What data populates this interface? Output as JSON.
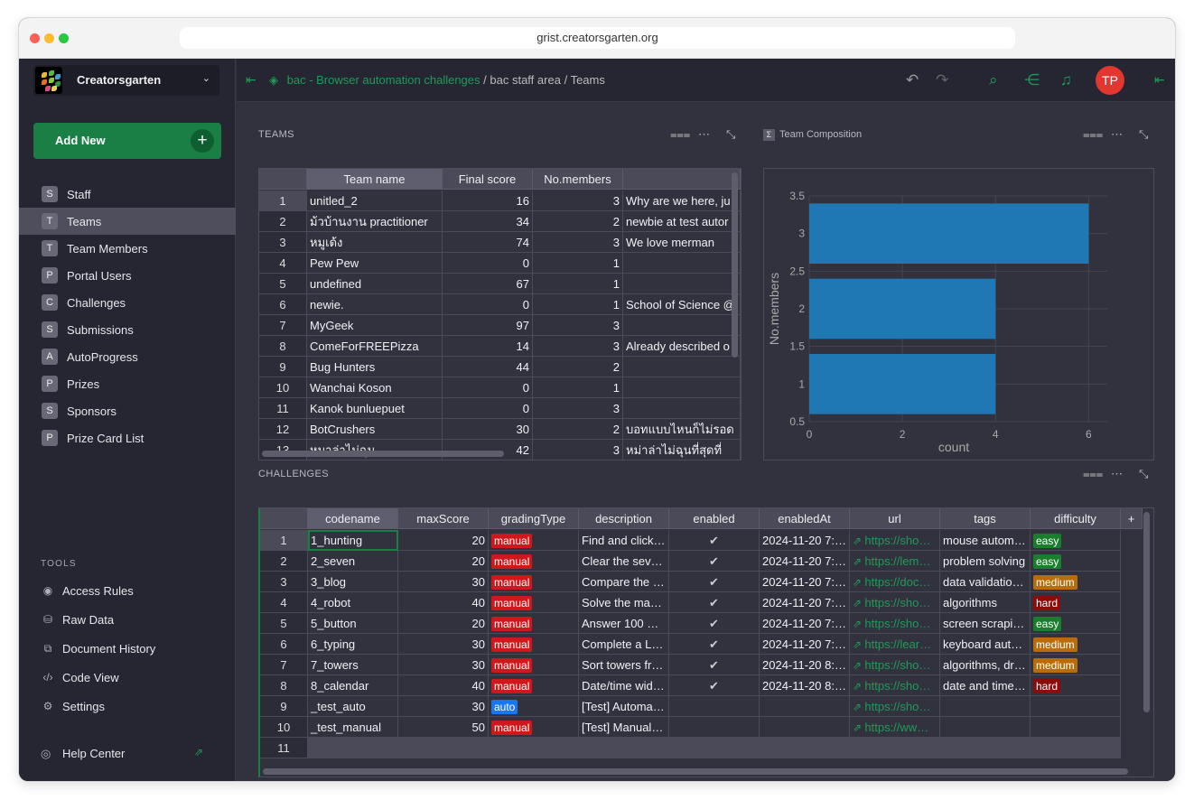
{
  "browser": {
    "url": "grist.creatorsgarten.org"
  },
  "org": {
    "name": "Creatorsgarten"
  },
  "sidebar": {
    "add_new": "Add New",
    "pages": [
      {
        "icon": "S",
        "label": "Staff"
      },
      {
        "icon": "T",
        "label": "Teams",
        "selected": true
      },
      {
        "icon": "T",
        "label": "Team Members"
      },
      {
        "icon": "P",
        "label": "Portal Users"
      },
      {
        "icon": "C",
        "label": "Challenges"
      },
      {
        "icon": "S",
        "label": "Submissions"
      },
      {
        "icon": "A",
        "label": "AutoProgress"
      },
      {
        "icon": "P",
        "label": "Prizes"
      },
      {
        "icon": "S",
        "label": "Sponsors"
      },
      {
        "icon": "P",
        "label": "Prize Card List"
      }
    ],
    "tools_heading": "TOOLS",
    "tools": [
      {
        "icon": "eye-icon",
        "label": "Access Rules"
      },
      {
        "icon": "database-icon",
        "label": "Raw Data"
      },
      {
        "icon": "history-icon",
        "label": "Document History"
      },
      {
        "icon": "code-icon",
        "label": "Code View"
      },
      {
        "icon": "gear-icon",
        "label": "Settings"
      }
    ],
    "help": "Help Center"
  },
  "topbar": {
    "breadcrumb": {
      "doc": "bac - Browser automation challenges",
      "sep1": "/",
      "workspace": "bac staff area",
      "sep2": "/",
      "page": "Teams"
    },
    "avatar_initials": "TP"
  },
  "teams": {
    "title": "TEAMS",
    "columns": [
      "Team name",
      "Final score",
      "No.members",
      ""
    ],
    "rows": [
      [
        "1",
        "unitled_2",
        "16",
        "3",
        "Why are we here, ju"
      ],
      [
        "2",
        "ม้วบ้านงาน practitioner",
        "34",
        "2",
        "newbie at test autor"
      ],
      [
        "3",
        "หมูเด้ง",
        "74",
        "3",
        "We love merman"
      ],
      [
        "4",
        "Pew Pew",
        "0",
        "1",
        ""
      ],
      [
        "5",
        "undefined",
        "67",
        "1",
        ""
      ],
      [
        "6",
        "newie.",
        "0",
        "1",
        "School of Science @"
      ],
      [
        "7",
        "MyGeek",
        "97",
        "3",
        ""
      ],
      [
        "8",
        "ComeForFREEPizza",
        "14",
        "3",
        "Already described o"
      ],
      [
        "9",
        "Bug Hunters",
        "44",
        "2",
        ""
      ],
      [
        "10",
        "Wanchai Koson",
        "0",
        "1",
        ""
      ],
      [
        "11",
        "Kanok bunluepuet",
        "0",
        "3",
        ""
      ],
      [
        "12",
        "BotCrushers",
        "30",
        "2",
        "บอทแบบไหนก็ไม่รอด"
      ],
      [
        "13",
        "หมาล่าไม่ฉุน",
        "42",
        "3",
        "หม่าล่าไม่ฉุนที่สุดที่"
      ]
    ]
  },
  "chart_widget": {
    "title": "Team Composition"
  },
  "chart_data": {
    "type": "bar",
    "orientation": "horizontal",
    "categories": [
      1,
      2,
      3
    ],
    "values": [
      4,
      4,
      6
    ],
    "xlabel": "count",
    "ylabel": "No.members",
    "xlim": [
      0,
      6.4
    ],
    "ylim": [
      0.5,
      3.5
    ],
    "xticks": [
      "0",
      "2",
      "4",
      "6"
    ],
    "yticks": [
      "0.5",
      "1",
      "1.5",
      "2",
      "2.5",
      "3",
      "3.5"
    ],
    "color": "#1f77b4",
    "grid": true
  },
  "challenges": {
    "title": "CHALLENGES",
    "columns": [
      "codename",
      "maxScore",
      "gradingType",
      "description",
      "enabled",
      "enabledAt",
      "url",
      "tags",
      "difficulty",
      "+"
    ],
    "rows": [
      {
        "n": "1",
        "codename": "1_hunting",
        "maxScore": "20",
        "grading": "manual",
        "description": "Find and click…",
        "enabled": "✔",
        "enabledAt": "2024-11-20 7:…",
        "url": "https://sho…",
        "tags": "mouse autom…",
        "difficulty": "easy"
      },
      {
        "n": "2",
        "codename": "2_seven",
        "maxScore": "20",
        "grading": "manual",
        "description": "Clear the sev…",
        "enabled": "✔",
        "enabledAt": "2024-11-20 7:…",
        "url": "https://lem…",
        "tags": "problem solving",
        "difficulty": "easy"
      },
      {
        "n": "3",
        "codename": "3_blog",
        "maxScore": "30",
        "grading": "manual",
        "description": "Compare the …",
        "enabled": "✔",
        "enabledAt": "2024-11-20 7:…",
        "url": "https://doc…",
        "tags": "data validatio…",
        "difficulty": "medium"
      },
      {
        "n": "4",
        "codename": "4_robot",
        "maxScore": "40",
        "grading": "manual",
        "description": "Solve the ma…",
        "enabled": "✔",
        "enabledAt": "2024-11-20 7:…",
        "url": "https://sho…",
        "tags": "algorithms",
        "difficulty": "hard"
      },
      {
        "n": "5",
        "codename": "5_button",
        "maxScore": "20",
        "grading": "manual",
        "description": "Answer 100 …",
        "enabled": "✔",
        "enabledAt": "2024-11-20 7:…",
        "url": "https://sho…",
        "tags": "screen scrapi…",
        "difficulty": "easy"
      },
      {
        "n": "6",
        "codename": "6_typing",
        "maxScore": "30",
        "grading": "manual",
        "description": "Complete a L…",
        "enabled": "✔",
        "enabledAt": "2024-11-20 7:…",
        "url": "https://lear…",
        "tags": "keyboard aut…",
        "difficulty": "medium"
      },
      {
        "n": "7",
        "codename": "7_towers",
        "maxScore": "30",
        "grading": "manual",
        "description": "Sort towers fr…",
        "enabled": "✔",
        "enabledAt": "2024-11-20 8:…",
        "url": "https://sho…",
        "tags": "algorithms, dr…",
        "difficulty": "medium"
      },
      {
        "n": "8",
        "codename": "8_calendar",
        "maxScore": "40",
        "grading": "manual",
        "description": "Date/time wid…",
        "enabled": "✔",
        "enabledAt": "2024-11-20 8:…",
        "url": "https://sho…",
        "tags": "date and time…",
        "difficulty": "hard"
      },
      {
        "n": "9",
        "codename": "_test_auto",
        "maxScore": "30",
        "grading": "auto",
        "description": "[Test] Automa…",
        "enabled": "",
        "enabledAt": "",
        "url": "https://sho…",
        "tags": "",
        "difficulty": ""
      },
      {
        "n": "10",
        "codename": "_test_manual",
        "maxScore": "50",
        "grading": "manual",
        "description": "[Test] Manual…",
        "enabled": "",
        "enabledAt": "",
        "url": "https://ww…",
        "tags": "",
        "difficulty": ""
      },
      {
        "n": "11",
        "codename": "",
        "maxScore": "",
        "grading": "",
        "description": "",
        "enabled": "",
        "enabledAt": "",
        "url": "",
        "tags": "",
        "difficulty": ""
      }
    ]
  },
  "colors": {
    "manual": "#d0181c",
    "auto": "#1877ef",
    "easy": "#1a7f2d",
    "medium": "#b86c0c",
    "hard": "#8c0b0b",
    "link": "#1e9b57"
  }
}
